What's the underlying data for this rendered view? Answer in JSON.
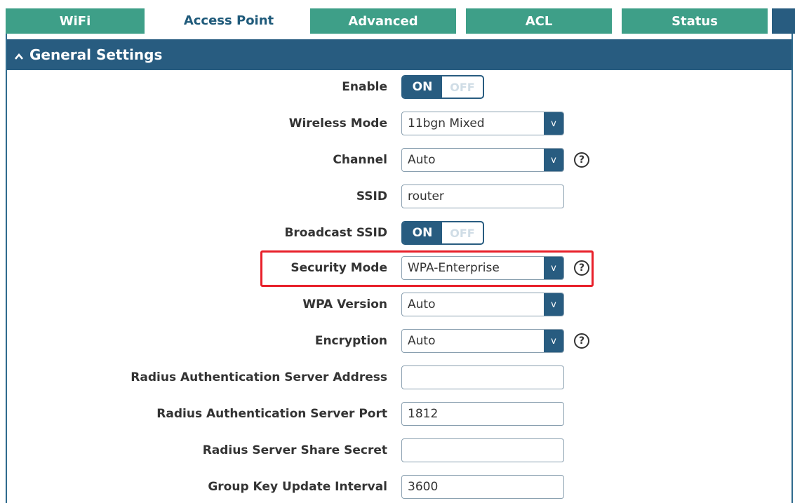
{
  "tabs": [
    {
      "label": "WiFi",
      "active": false
    },
    {
      "label": "Access Point",
      "active": true
    },
    {
      "label": "Advanced",
      "active": false
    },
    {
      "label": "ACL",
      "active": false
    },
    {
      "label": "Status",
      "active": false
    }
  ],
  "section": {
    "title": "General Settings",
    "icon": "chevron-up-icon"
  },
  "fields": {
    "enable": {
      "label": "Enable",
      "on": "ON",
      "off": "OFF"
    },
    "wireless_mode": {
      "label": "Wireless Mode",
      "value": "11bgn Mixed"
    },
    "channel": {
      "label": "Channel",
      "value": "Auto"
    },
    "ssid": {
      "label": "SSID",
      "value": "router"
    },
    "broadcast_ssid": {
      "label": "Broadcast SSID",
      "on": "ON",
      "off": "OFF"
    },
    "security_mode": {
      "label": "Security Mode",
      "value": "WPA-Enterprise"
    },
    "wpa_version": {
      "label": "WPA Version",
      "value": "Auto"
    },
    "encryption": {
      "label": "Encryption",
      "value": "Auto"
    },
    "radius_addr": {
      "label": "Radius Authentication Server Address",
      "value": ""
    },
    "radius_port": {
      "label": "Radius Authentication Server Port",
      "value": "1812"
    },
    "radius_secret": {
      "label": "Radius Server Share Secret",
      "value": ""
    },
    "group_key_interval": {
      "label": "Group Key Update Interval",
      "value": "3600"
    }
  },
  "select_arrow": "v",
  "help_glyph": "?",
  "colors": {
    "accent": "#285c80",
    "tab": "#3e9f88",
    "highlight": "#e8202a"
  }
}
